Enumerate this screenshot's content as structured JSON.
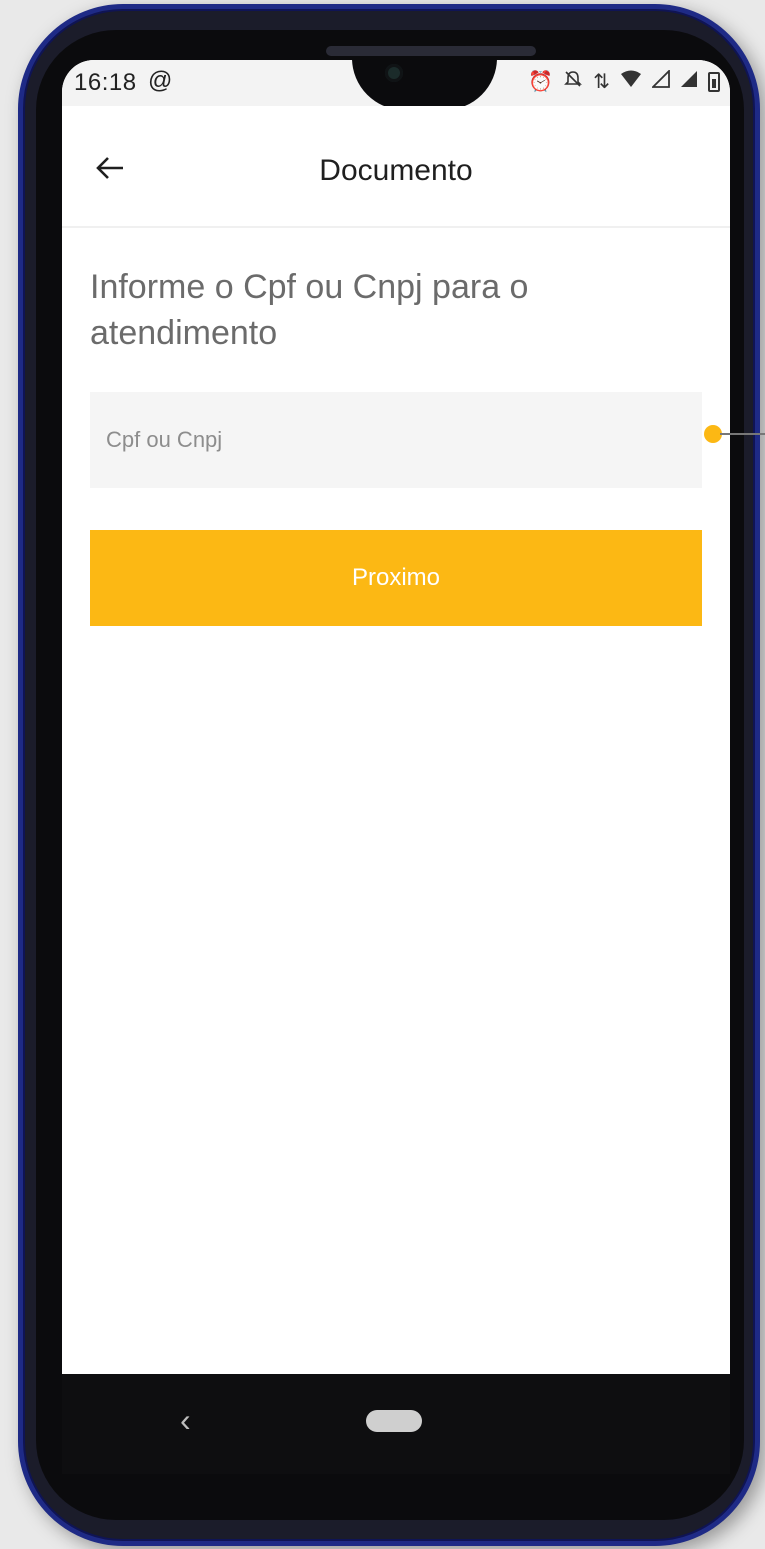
{
  "status_bar": {
    "time": "16:18",
    "sync_icon": "at-icon",
    "icons": [
      "alarm-icon",
      "silent-icon",
      "data-arrows-icon",
      "wifi-icon",
      "signal-icon",
      "signal-icon",
      "battery-icon"
    ]
  },
  "app_bar": {
    "back_icon": "arrow-left-icon",
    "title": "Documento"
  },
  "main": {
    "prompt": "Informe o Cpf ou Cnpj para o atendimento",
    "document_input": {
      "value": "",
      "placeholder": "Cpf ou Cnpj"
    },
    "next_button_label": "Proximo"
  },
  "nav_bar": {
    "back_icon": "chevron-left-icon",
    "home_icon": "home-pill-icon"
  },
  "colors": {
    "accent": "#fcb814",
    "phone_frame": "#1e2a86",
    "input_bg": "#f5f5f5",
    "prompt_text": "#6b6b6b"
  }
}
